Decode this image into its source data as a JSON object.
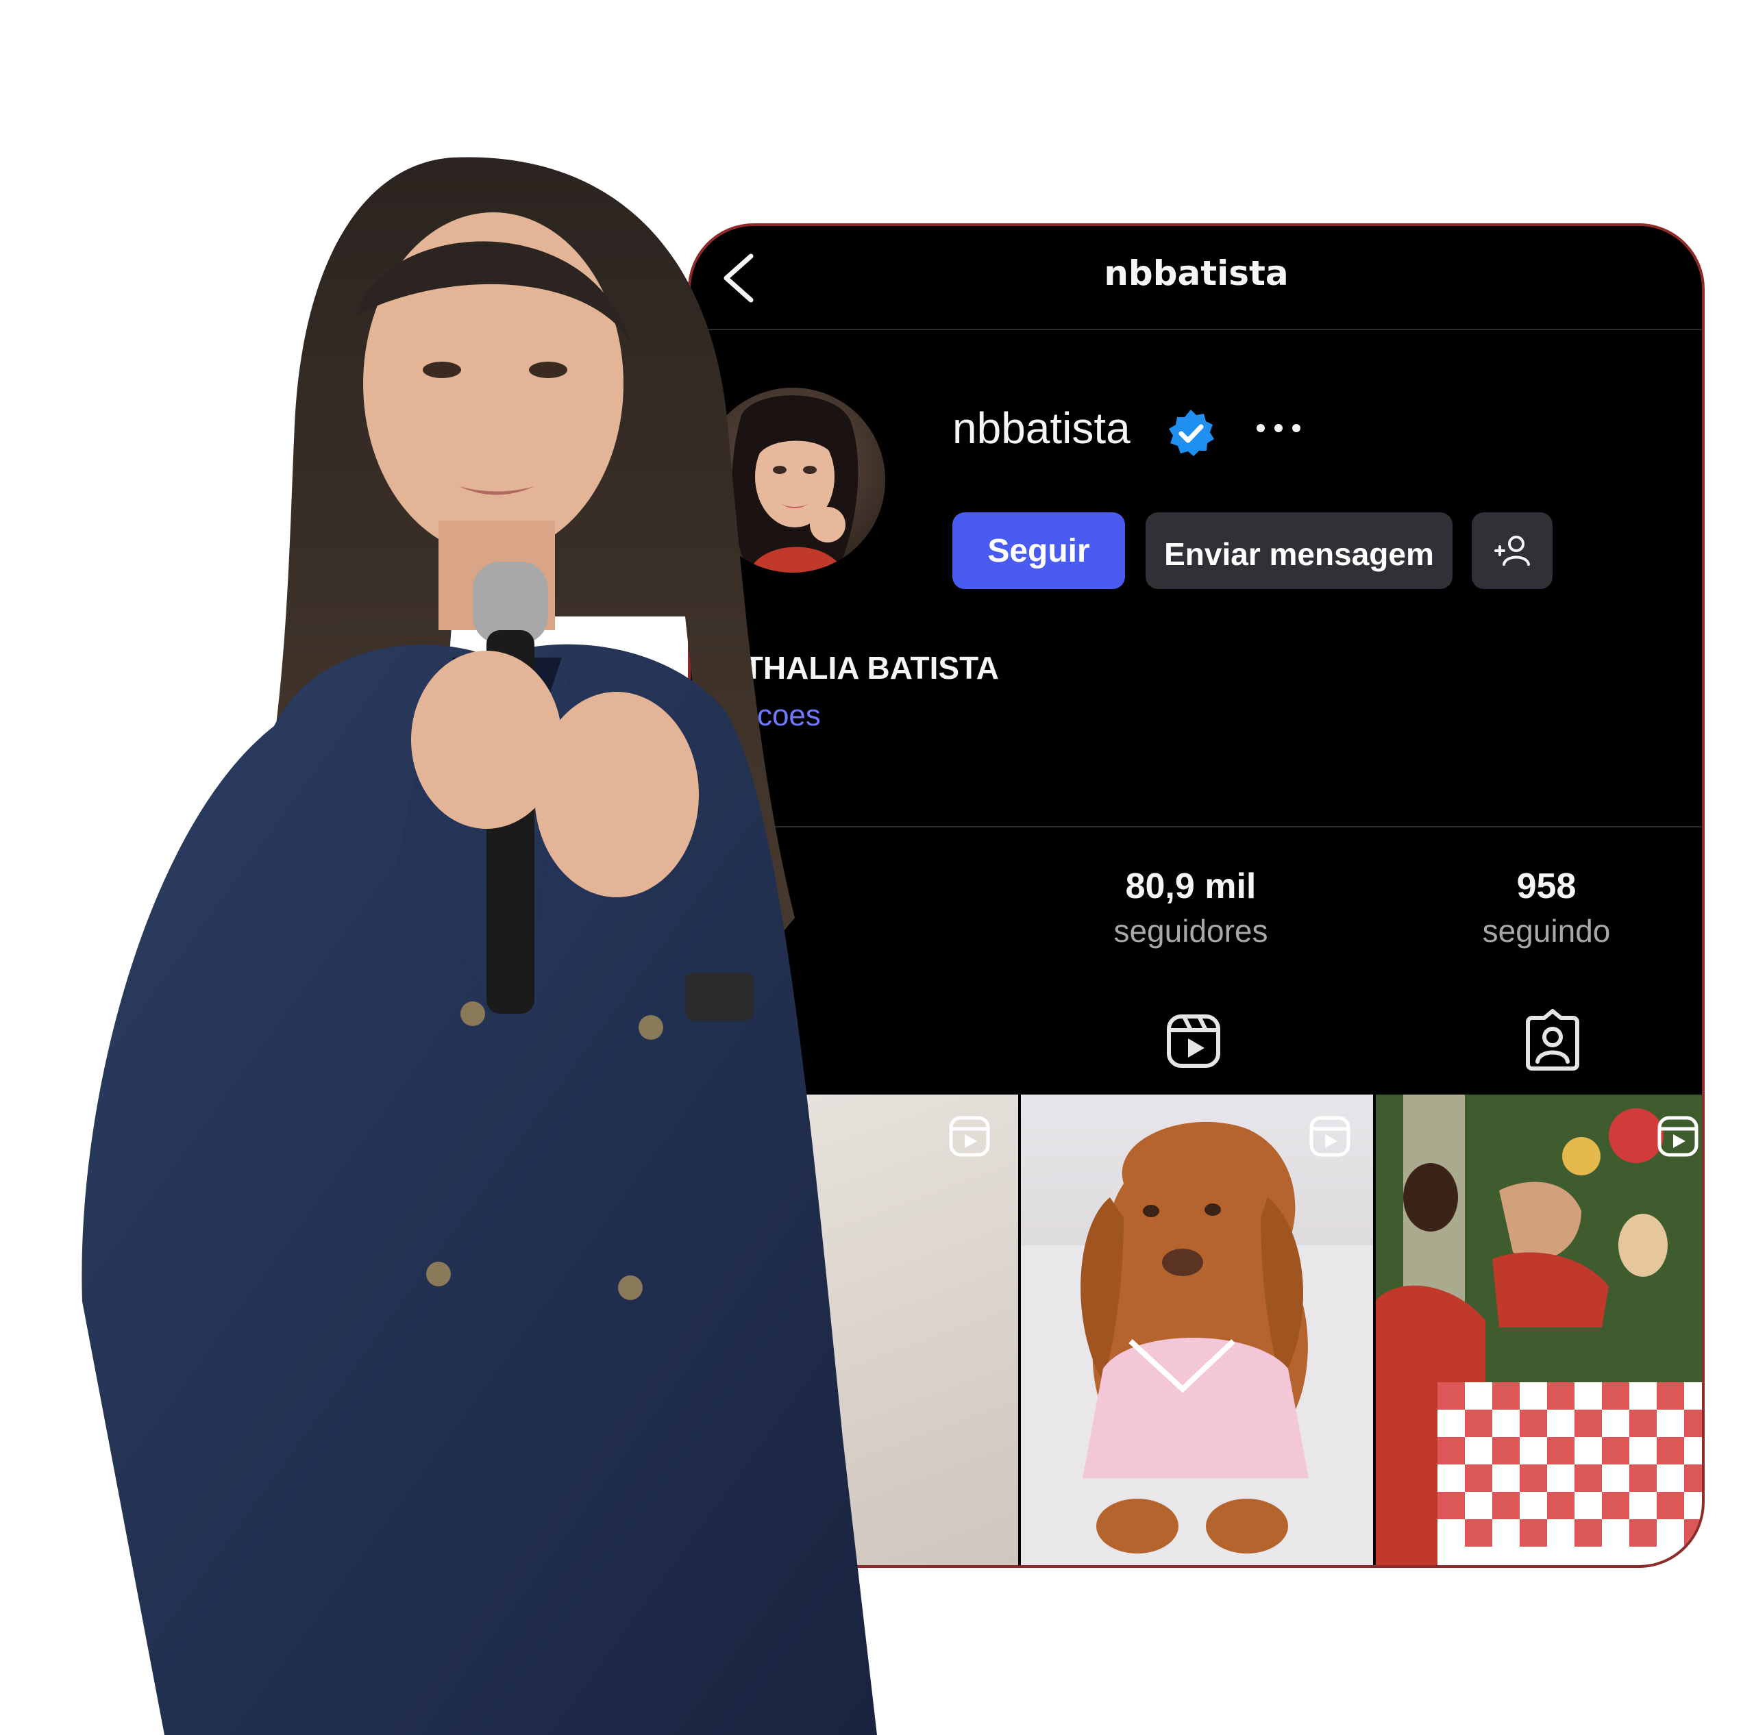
{
  "profile": {
    "header_title": "nbbatista",
    "username": "nbbatista",
    "full_name": "ATHALIA BATISTA",
    "bio_link": "ducoes",
    "verified": true
  },
  "actions": {
    "follow_label": "Seguir",
    "message_label": "Enviar mensagem"
  },
  "stats": {
    "followers_count": "80,9 mil",
    "followers_label": "seguidores",
    "following_count": "958",
    "following_label": "seguindo"
  },
  "icons": {
    "back": "chevron-left-icon",
    "verified": "verified-badge-icon",
    "more": "more-horizontal-icon",
    "add_user": "add-user-icon",
    "reels_tab": "reels-icon",
    "tagged_tab": "tagged-icon"
  },
  "colors": {
    "background": "#000000",
    "accent_button": "#4a5cf0",
    "secondary_button": "#2f3136",
    "link": "#6f78ff",
    "verified_blue": "#1f8ff0",
    "card_border": "#8f2a2a"
  }
}
